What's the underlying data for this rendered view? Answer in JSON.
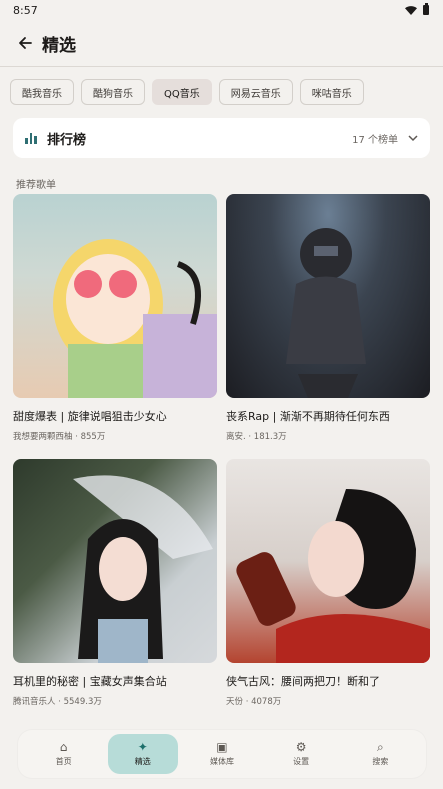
{
  "status_bar": {
    "time": "8:57"
  },
  "header": {
    "title": "精选"
  },
  "chips": [
    {
      "label": "酷我音乐",
      "selected": false
    },
    {
      "label": "酷狗音乐",
      "selected": false
    },
    {
      "label": "QQ音乐",
      "selected": true
    },
    {
      "label": "网易云音乐",
      "selected": false
    },
    {
      "label": "咪咕音乐",
      "selected": false
    }
  ],
  "ranking": {
    "title": "排行榜",
    "count": "17 个榜单"
  },
  "section": {
    "title": "推荐歌单"
  },
  "playlists": [
    {
      "title": "甜度爆表 | 旋律说唱狙击少女心",
      "subtitle": "我想要两颗西柚 · 855万"
    },
    {
      "title": "丧系Rap | 渐渐不再期待任何东西",
      "subtitle": "离安. · 181.3万"
    },
    {
      "title": "耳机里的秘密 | 宝藏女声集合站",
      "subtitle": "腾讯音乐人 · 5549.3万"
    },
    {
      "title": "侠气古风：腰间两把刀！断和了",
      "subtitle": "天份 · 4078万"
    }
  ],
  "bottom_nav": [
    {
      "label": "首页",
      "icon": "home-icon",
      "active": false
    },
    {
      "label": "精选",
      "icon": "sparkle-icon",
      "active": true
    },
    {
      "label": "媒体库",
      "icon": "library-icon",
      "active": false
    },
    {
      "label": "设置",
      "icon": "gear-icon",
      "active": false
    },
    {
      "label": "搜索",
      "icon": "search-icon",
      "active": false
    }
  ],
  "colors": {
    "accent": "#b7dcd8",
    "background": "#f3f1ee",
    "ranking_icon": "#2f6f73"
  }
}
